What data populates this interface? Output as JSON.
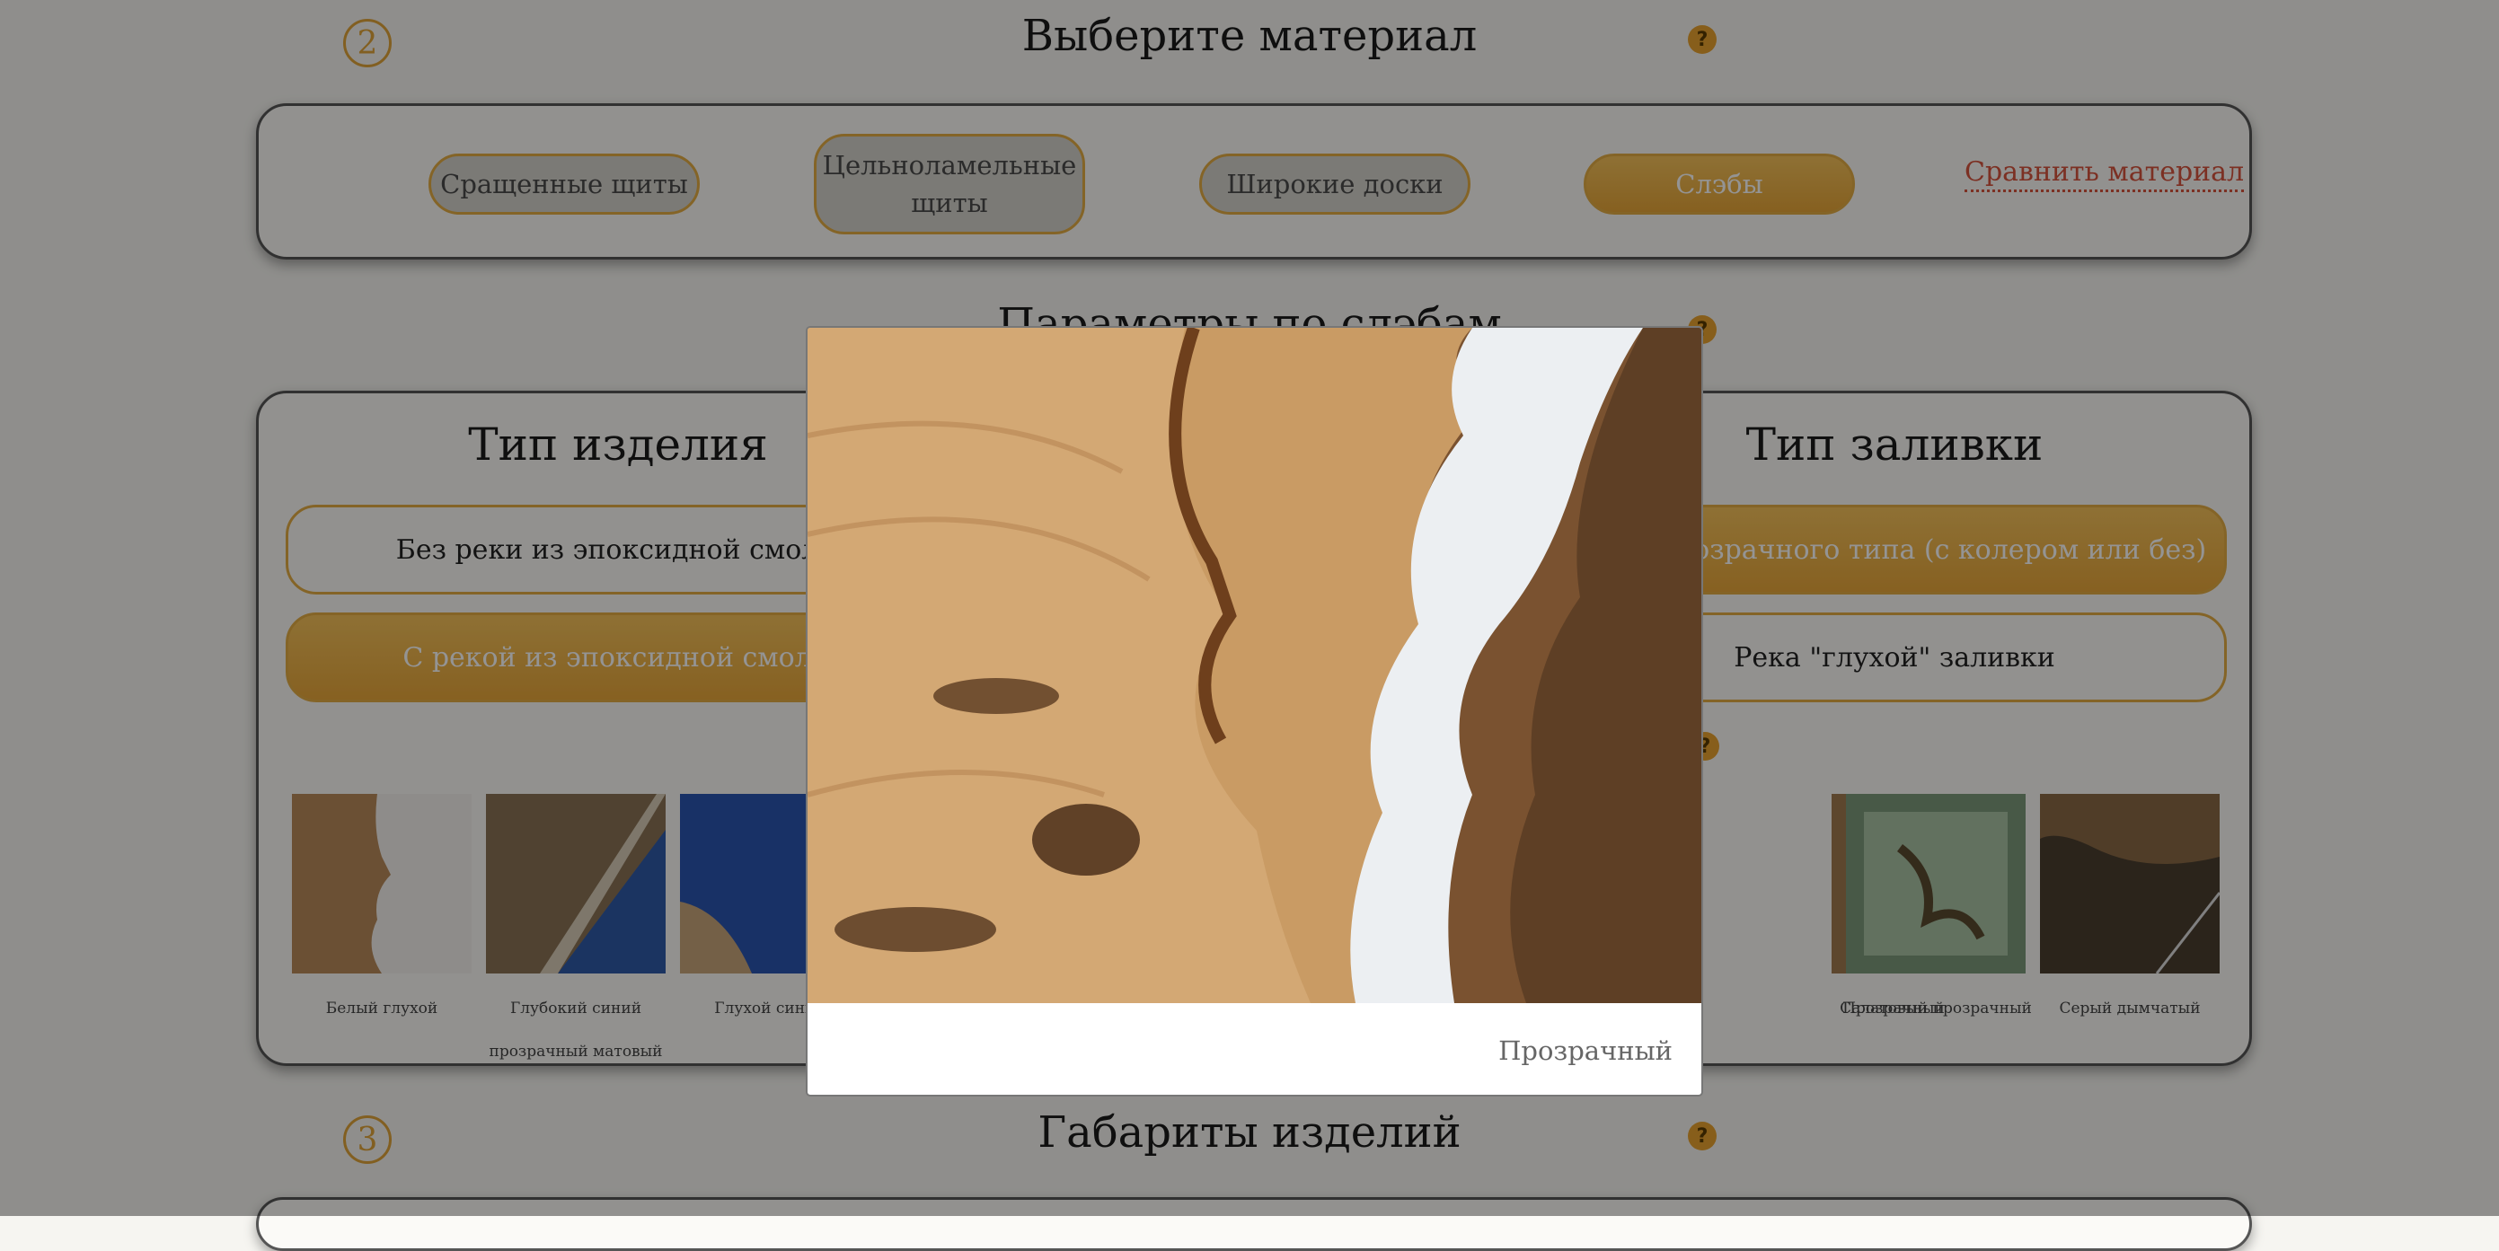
{
  "step2": {
    "number": "2",
    "title": "Выберите материал",
    "help": "?",
    "materials": [
      {
        "label": "Сращенные щиты",
        "active": false
      },
      {
        "label": "Цельноламельные щиты",
        "active": false
      },
      {
        "label": "Широкие доски",
        "active": false
      },
      {
        "label": "Слэбы",
        "active": true
      }
    ],
    "compare_link": "Сравнить материал"
  },
  "params": {
    "title": "Параметры по слэбам",
    "help": "?",
    "product_type": {
      "title": "Тип изделия",
      "options": [
        {
          "label": "Без реки из эпоксидной смолы",
          "active": false
        },
        {
          "label": "С рекой из эпоксидной смолы",
          "active": true
        }
      ]
    },
    "fill_type": {
      "title": "Тип заливки",
      "options": [
        {
          "label": "Река прозрачного типа (с колером или без)",
          "active": true
        },
        {
          "label": "Река \"глухой\" заливки",
          "active": false
        }
      ]
    },
    "colors_help": "?",
    "colors": [
      {
        "caption_line1": "Белый глухой",
        "caption_line2": ""
      },
      {
        "caption_line1": "Глубокий синий",
        "caption_line2": "прозрачный матовый"
      },
      {
        "caption_line1": "Глухой синий",
        "caption_line2": ""
      },
      {
        "caption_line1": "Прозрачный",
        "caption_line2": ""
      },
      {
        "caption_line1": "Салатовый прозрачный",
        "caption_line2": ""
      },
      {
        "caption_line1": "Серый дымчатый",
        "caption_line2": ""
      }
    ]
  },
  "step3": {
    "number": "3",
    "title": "Габариты изделий",
    "help": "?"
  },
  "modal": {
    "caption": "Прозрачный",
    "colors": {
      "wood": "#c79a63",
      "resin": "#e8ebee",
      "dark_wood": "#5a3b22"
    }
  }
}
